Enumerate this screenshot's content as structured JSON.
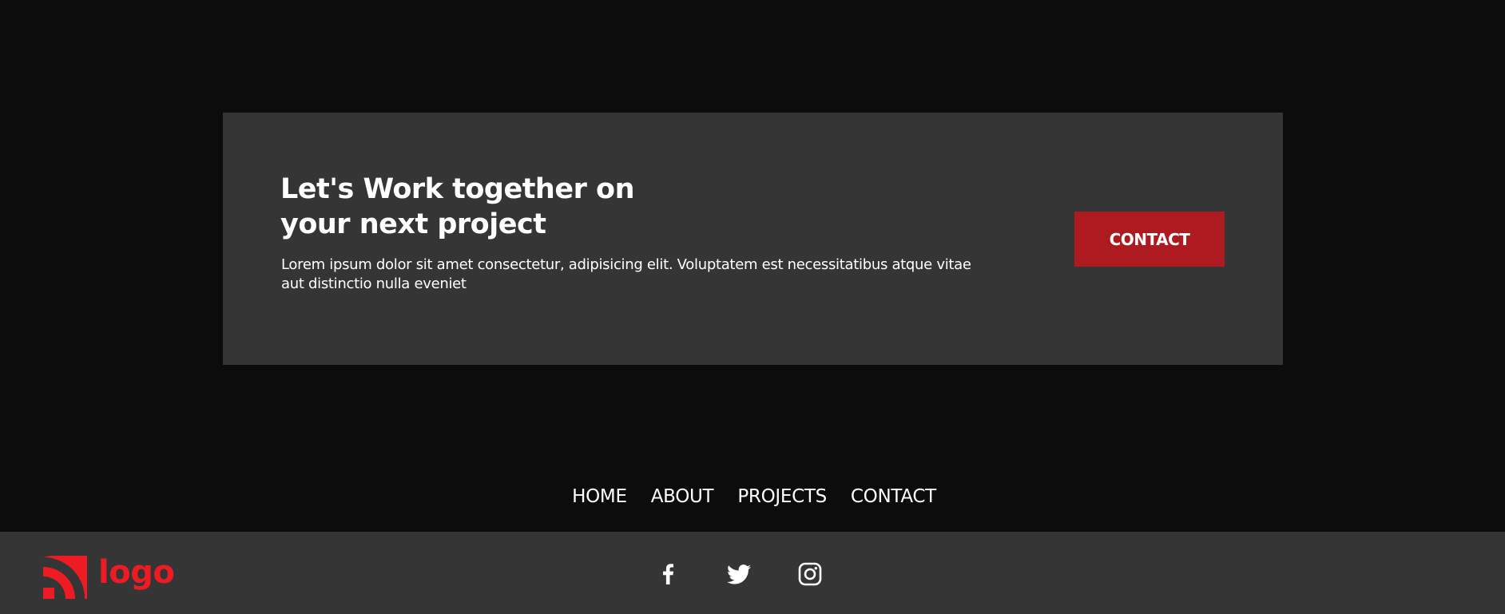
{
  "cta": {
    "title_line1": "Let's Work together on",
    "title_line2": "your next project",
    "text": "Lorem ipsum dolor sit amet consectetur, adipisicing elit. Voluptatem est necessitatibus atque vitae aut distinctio nulla eveniet",
    "button_label": "CONTACT"
  },
  "footer": {
    "nav": [
      {
        "label": "HOME"
      },
      {
        "label": "ABOUT"
      },
      {
        "label": "PROJECTS"
      },
      {
        "label": "CONTACT"
      }
    ],
    "logo_text": "logo",
    "social": [
      {
        "icon": "facebook-icon"
      },
      {
        "icon": "twitter-icon"
      },
      {
        "icon": "instagram-icon"
      }
    ]
  },
  "colors": {
    "page_background": "#0c0c0c",
    "card_background": "#353535",
    "accent": "#ad1a1f",
    "logo": "#ed1c24",
    "text": "#ffffff"
  }
}
